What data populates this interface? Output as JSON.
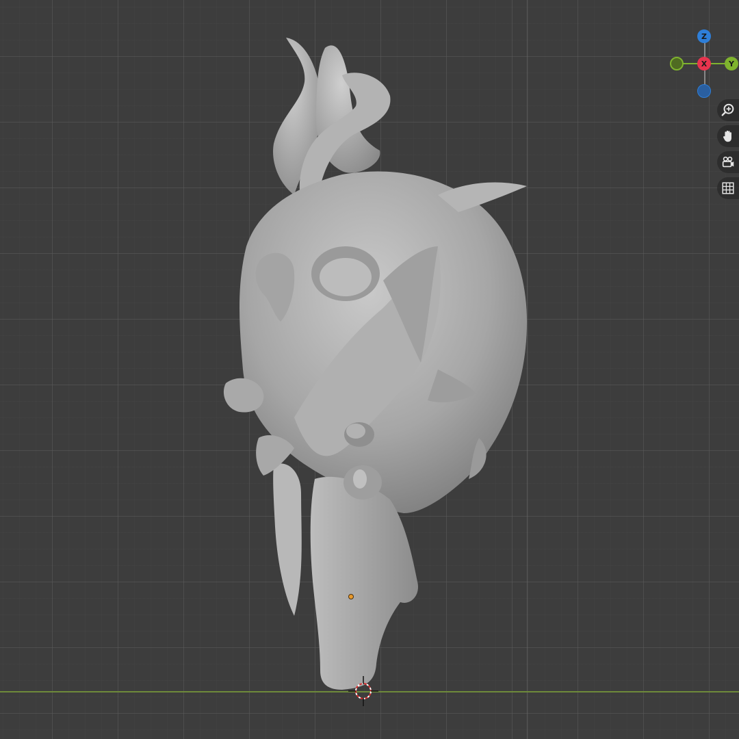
{
  "viewport": {
    "background_color": "#3d3d3d",
    "grid_color": "#5a5a5a",
    "x_axis_color": "#6e8a3a"
  },
  "gizmo": {
    "z_label": "Z",
    "x_label": "X",
    "y_label": "Y",
    "z_color": "#2e7fd9",
    "x_color": "#e8344e",
    "y_color": "#7fb32e"
  },
  "nav_buttons": [
    {
      "icon": "zoom-icon"
    },
    {
      "icon": "hand-pan-icon"
    },
    {
      "icon": "camera-view-icon"
    },
    {
      "icon": "grid-ortho-icon"
    }
  ],
  "model": {
    "name_hint": "sculpted-creature-mesh",
    "color": "#a9a9a9"
  }
}
